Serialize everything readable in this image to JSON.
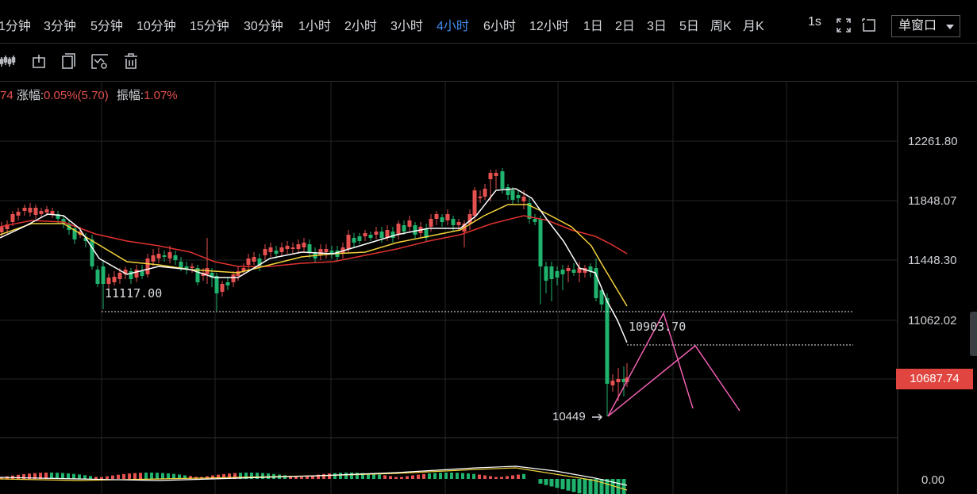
{
  "toolbar": {
    "timeframes": [
      "1分钟",
      "3分钟",
      "5分钟",
      "10分钟",
      "15分钟",
      "30分钟",
      "1小时",
      "2小时",
      "3小时",
      "4小时",
      "6小时",
      "12小时",
      "1日",
      "2日",
      "3日",
      "5日",
      "周K",
      "月K"
    ],
    "active": "4小时",
    "seconds_label": "1s",
    "window_select": "单窗口"
  },
  "stats": {
    "prefix": "74",
    "change_label": "涨幅:",
    "change_value": "0.05%(5.70)",
    "amplitude_label": "振幅:",
    "amplitude_value": "1.07%"
  },
  "price_axis": [
    "12261.80",
    "11848.07",
    "11448.30",
    "11062.02"
  ],
  "current_price": "10687.74",
  "indicator_axis": "0.00",
  "annotations": {
    "low_left": "11117.00",
    "level_right": "10903.70",
    "low_marker": "10449"
  },
  "colors": {
    "up": "#e5514f",
    "down": "#1fb36e",
    "ma_fast": "#ffffff",
    "ma_mid": "#f3d23a",
    "ma_slow": "#e0322f",
    "drawing": "#ee5fb0",
    "active_tab": "#3f8ef2"
  },
  "icons": [
    "fullscreen-icon",
    "screenshot-icon",
    "indicator-icon",
    "text-icon",
    "copy-icon",
    "draw-settings-icon",
    "delete-icon"
  ]
}
